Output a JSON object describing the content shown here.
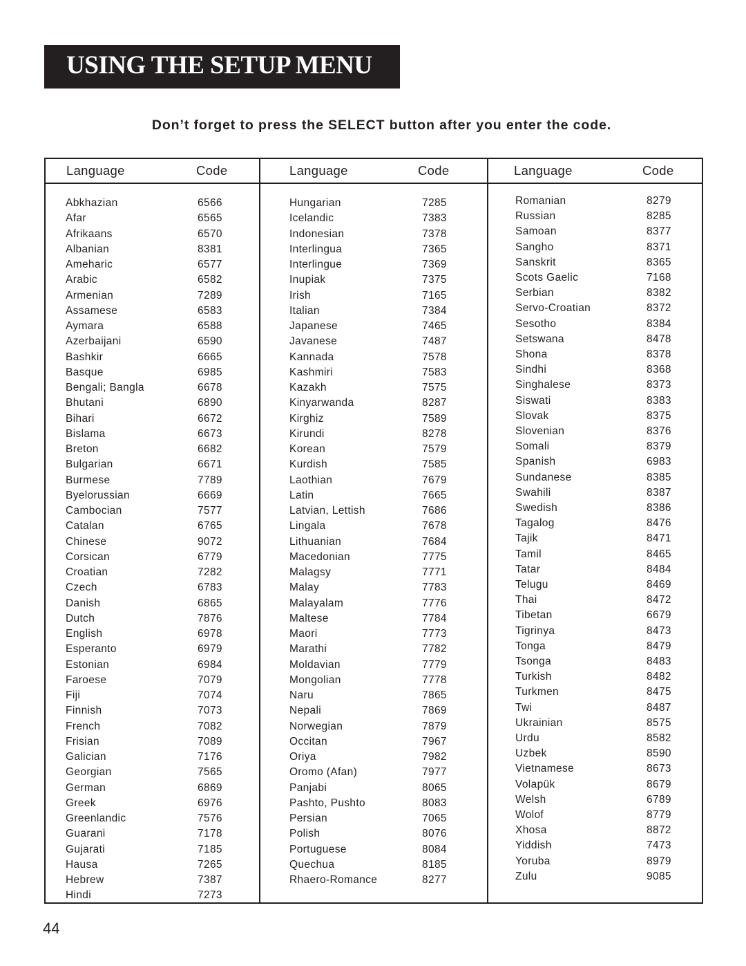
{
  "header": {
    "title": "USING THE SETUP MENU",
    "instruction": "Don’t forget to press the SELECT button after you enter the code."
  },
  "table": {
    "columns": [
      {
        "language_header": "Language",
        "code_header": "Code",
        "rows": [
          {
            "language": "Abkhazian",
            "code": "6566"
          },
          {
            "language": "Afar",
            "code": "6565"
          },
          {
            "language": "Afrikaans",
            "code": "6570"
          },
          {
            "language": "Albanian",
            "code": "8381"
          },
          {
            "language": "Ameharic",
            "code": "6577"
          },
          {
            "language": "Arabic",
            "code": "6582"
          },
          {
            "language": "Armenian",
            "code": "7289"
          },
          {
            "language": "Assamese",
            "code": "6583"
          },
          {
            "language": "Aymara",
            "code": "6588"
          },
          {
            "language": "Azerbaijani",
            "code": "6590"
          },
          {
            "language": "Bashkir",
            "code": "6665"
          },
          {
            "language": "Basque",
            "code": "6985"
          },
          {
            "language": "Bengali; Bangla",
            "code": "6678"
          },
          {
            "language": "Bhutani",
            "code": "6890"
          },
          {
            "language": "Bihari",
            "code": "6672"
          },
          {
            "language": "Bislama",
            "code": "6673"
          },
          {
            "language": "Breton",
            "code": "6682"
          },
          {
            "language": "Bulgarian",
            "code": "6671"
          },
          {
            "language": "Burmese",
            "code": "7789"
          },
          {
            "language": "Byelorussian",
            "code": "6669"
          },
          {
            "language": "Cambocian",
            "code": "7577"
          },
          {
            "language": "Catalan",
            "code": "6765"
          },
          {
            "language": "Chinese",
            "code": "9072"
          },
          {
            "language": "Corsican",
            "code": "6779"
          },
          {
            "language": "Croatian",
            "code": "7282"
          },
          {
            "language": "Czech",
            "code": "6783"
          },
          {
            "language": "Danish",
            "code": "6865"
          },
          {
            "language": "Dutch",
            "code": "7876"
          },
          {
            "language": "English",
            "code": "6978"
          },
          {
            "language": "Esperanto",
            "code": "6979"
          },
          {
            "language": "Estonian",
            "code": "6984"
          },
          {
            "language": "Faroese",
            "code": "7079"
          },
          {
            "language": "Fiji",
            "code": "7074"
          },
          {
            "language": "Finnish",
            "code": "7073"
          },
          {
            "language": "French",
            "code": "7082"
          },
          {
            "language": "Frisian",
            "code": "7089"
          },
          {
            "language": "Galician",
            "code": "7176"
          },
          {
            "language": "Georgian",
            "code": "7565"
          },
          {
            "language": "German",
            "code": "6869"
          },
          {
            "language": "Greek",
            "code": "6976"
          },
          {
            "language": "Greenlandic",
            "code": "7576"
          },
          {
            "language": "Guarani",
            "code": "7178"
          },
          {
            "language": "Gujarati",
            "code": "7185"
          },
          {
            "language": "Hausa",
            "code": "7265"
          },
          {
            "language": "Hebrew",
            "code": "7387"
          },
          {
            "language": "Hindi",
            "code": "7273"
          }
        ]
      },
      {
        "language_header": "Language",
        "code_header": "Code",
        "rows": [
          {
            "language": "Hungarian",
            "code": "7285"
          },
          {
            "language": "Icelandic",
            "code": "7383"
          },
          {
            "language": "Indonesian",
            "code": "7378"
          },
          {
            "language": "Interlingua",
            "code": "7365"
          },
          {
            "language": "Interlingue",
            "code": "7369"
          },
          {
            "language": "Inupiak",
            "code": "7375"
          },
          {
            "language": "Irish",
            "code": "7165"
          },
          {
            "language": "Italian",
            "code": "7384"
          },
          {
            "language": "Japanese",
            "code": "7465"
          },
          {
            "language": "Javanese",
            "code": "7487"
          },
          {
            "language": "Kannada",
            "code": "7578"
          },
          {
            "language": "Kashmiri",
            "code": "7583"
          },
          {
            "language": "Kazakh",
            "code": "7575"
          },
          {
            "language": "Kinyarwanda",
            "code": "8287"
          },
          {
            "language": "Kirghiz",
            "code": "7589"
          },
          {
            "language": "Kirundi",
            "code": "8278"
          },
          {
            "language": "Korean",
            "code": "7579"
          },
          {
            "language": "Kurdish",
            "code": "7585"
          },
          {
            "language": "Laothian",
            "code": "7679"
          },
          {
            "language": "Latin",
            "code": "7665"
          },
          {
            "language": "Latvian, Lettish",
            "code": "7686"
          },
          {
            "language": "Lingala",
            "code": "7678"
          },
          {
            "language": "Lithuanian",
            "code": "7684"
          },
          {
            "language": "Macedonian",
            "code": "7775"
          },
          {
            "language": "Malagsy",
            "code": "7771"
          },
          {
            "language": "Malay",
            "code": "7783"
          },
          {
            "language": "Malayalam",
            "code": "7776"
          },
          {
            "language": "Maltese",
            "code": "7784"
          },
          {
            "language": "Maori",
            "code": "7773"
          },
          {
            "language": "Marathi",
            "code": "7782"
          },
          {
            "language": "Moldavian",
            "code": "7779"
          },
          {
            "language": "Mongolian",
            "code": "7778"
          },
          {
            "language": "Naru",
            "code": "7865"
          },
          {
            "language": "Nepali",
            "code": "7869"
          },
          {
            "language": "Norwegian",
            "code": "7879"
          },
          {
            "language": "Occitan",
            "code": "7967"
          },
          {
            "language": "Oriya",
            "code": "7982"
          },
          {
            "language": "Oromo (Afan)",
            "code": "7977"
          },
          {
            "language": "Panjabi",
            "code": "8065"
          },
          {
            "language": "Pashto, Pushto",
            "code": "8083"
          },
          {
            "language": "Persian",
            "code": "7065"
          },
          {
            "language": "Polish",
            "code": "8076"
          },
          {
            "language": "Portuguese",
            "code": "8084"
          },
          {
            "language": "Quechua",
            "code": "8185"
          },
          {
            "language": "Rhaero-Romance",
            "code": "8277"
          }
        ]
      },
      {
        "language_header": "Language",
        "code_header": "Code",
        "rows": [
          {
            "language": "Romanian",
            "code": "8279"
          },
          {
            "language": "Russian",
            "code": "8285"
          },
          {
            "language": "Samoan",
            "code": "8377"
          },
          {
            "language": "Sangho",
            "code": "8371"
          },
          {
            "language": "Sanskrit",
            "code": "8365"
          },
          {
            "language": "Scots Gaelic",
            "code": "7168"
          },
          {
            "language": "Serbian",
            "code": "8382"
          },
          {
            "language": "Servo-Croatian",
            "code": "8372"
          },
          {
            "language": "Sesotho",
            "code": "8384"
          },
          {
            "language": "Setswana",
            "code": "8478"
          },
          {
            "language": "Shona",
            "code": "8378"
          },
          {
            "language": "Sindhi",
            "code": "8368"
          },
          {
            "language": "Singhalese",
            "code": "8373"
          },
          {
            "language": "Siswati",
            "code": "8383"
          },
          {
            "language": "Slovak",
            "code": "8375"
          },
          {
            "language": "Slovenian",
            "code": "8376"
          },
          {
            "language": "Somali",
            "code": "8379"
          },
          {
            "language": "Spanish",
            "code": "6983"
          },
          {
            "language": "Sundanese",
            "code": "8385"
          },
          {
            "language": "Swahili",
            "code": "8387"
          },
          {
            "language": "Swedish",
            "code": "8386"
          },
          {
            "language": "Tagalog",
            "code": "8476"
          },
          {
            "language": "Tajik",
            "code": "8471"
          },
          {
            "language": "Tamil",
            "code": "8465"
          },
          {
            "language": "Tatar",
            "code": "8484"
          },
          {
            "language": "Telugu",
            "code": "8469"
          },
          {
            "language": "Thai",
            "code": "8472"
          },
          {
            "language": "Tibetan",
            "code": "6679"
          },
          {
            "language": "Tigrinya",
            "code": "8473"
          },
          {
            "language": "Tonga",
            "code": "8479"
          },
          {
            "language": "Tsonga",
            "code": "8483"
          },
          {
            "language": "Turkish",
            "code": "8482"
          },
          {
            "language": "Turkmen",
            "code": "8475"
          },
          {
            "language": "Twi",
            "code": "8487"
          },
          {
            "language": "Ukrainian",
            "code": "8575"
          },
          {
            "language": "Urdu",
            "code": "8582"
          },
          {
            "language": "Uzbek",
            "code": "8590"
          },
          {
            "language": "Vietnamese",
            "code": "8673"
          },
          {
            "language": "Volapük",
            "code": "8679"
          },
          {
            "language": "Welsh",
            "code": "6789"
          },
          {
            "language": "Wolof",
            "code": "8779"
          },
          {
            "language": "Xhosa",
            "code": "8872"
          },
          {
            "language": "Yiddish",
            "code": "7473"
          },
          {
            "language": "Yoruba",
            "code": "8979"
          },
          {
            "language": "Zulu",
            "code": "9085"
          }
        ]
      }
    ]
  },
  "footer": {
    "page_number": "44"
  }
}
